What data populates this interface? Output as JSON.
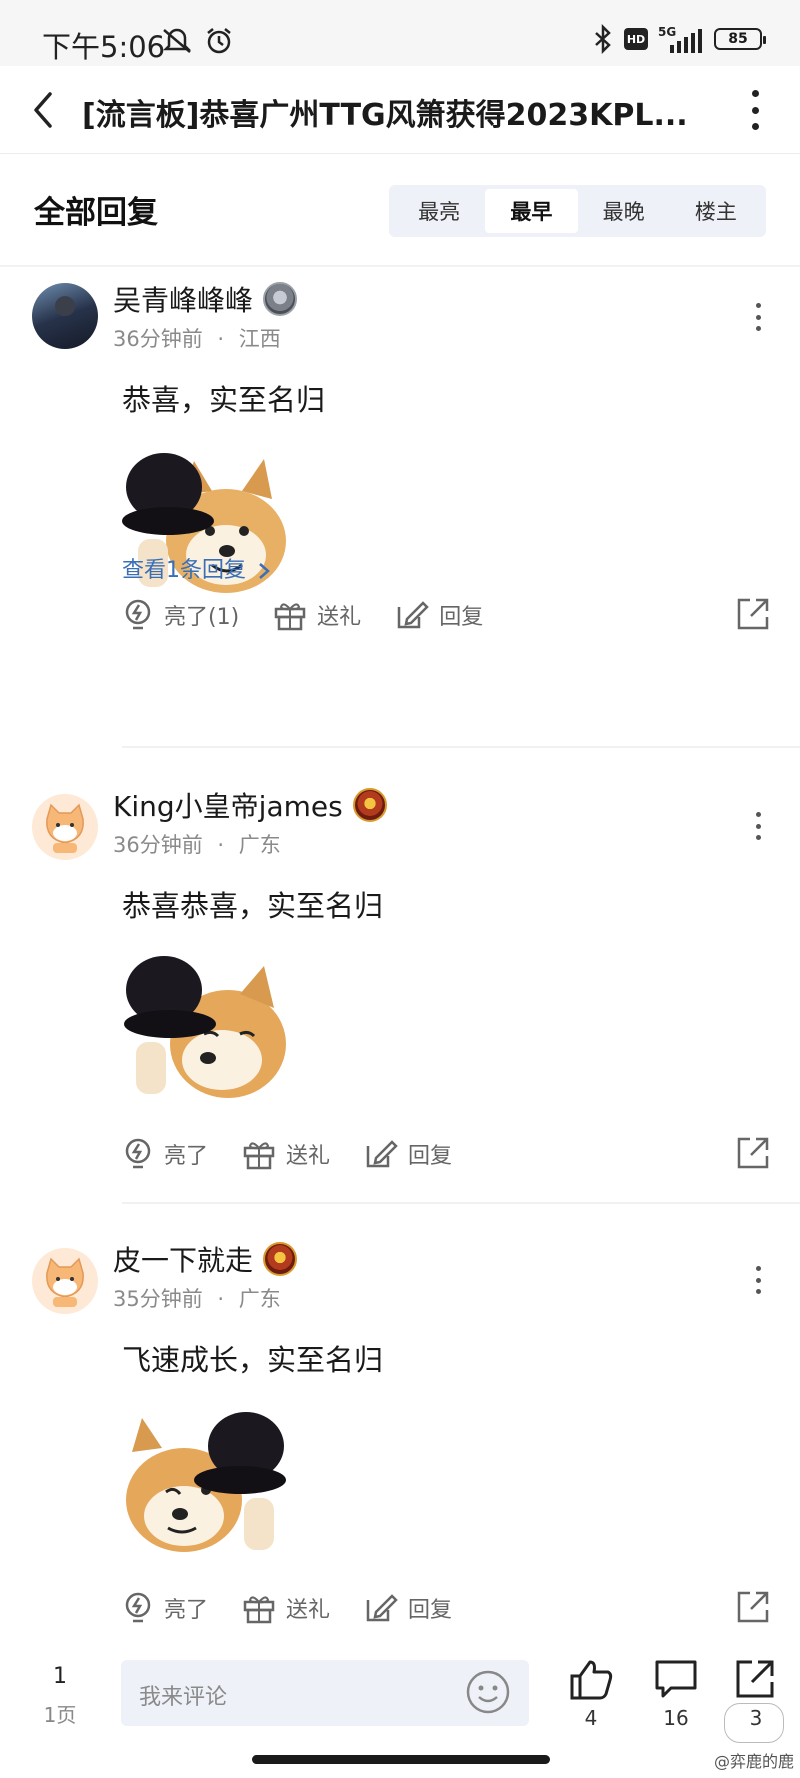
{
  "status_bar": {
    "time": "下午5:06",
    "network": "5G",
    "hd": "HD",
    "battery": "85"
  },
  "header": {
    "title": "[流言板]恭喜广州TTG风箫获得2023KPL..."
  },
  "sort": {
    "section_title": "全部回复",
    "options": [
      "最亮",
      "最早",
      "最晚",
      "楼主"
    ],
    "active": "最早"
  },
  "comments": [
    {
      "username": "吴青峰峰峰",
      "time": "36分钟前",
      "location": "江西",
      "text": "恭喜，实至名归",
      "replies_link": "查看1条回复",
      "actions": {
        "light": "亮了(1)",
        "gift": "送礼",
        "reply": "回复"
      }
    },
    {
      "username": "King小皇帝james",
      "time": "36分钟前",
      "location": "广东",
      "text": "恭喜恭喜，实至名归",
      "actions": {
        "light": "亮了",
        "gift": "送礼",
        "reply": "回复"
      }
    },
    {
      "username": "皮一下就走",
      "time": "35分钟前",
      "location": "广东",
      "text": "飞速成长，实至名归",
      "actions": {
        "light": "亮了",
        "gift": "送礼",
        "reply": "回复"
      }
    }
  ],
  "meta_separator": "·",
  "bottom_bar": {
    "page_number": "1",
    "page_label": "1页",
    "comment_placeholder": "我来评论",
    "likes": "4",
    "comments": "16",
    "shares": "3"
  },
  "watermark": "@弈鹿的鹿",
  "colors": {
    "link_blue": "#3a6fb7",
    "segment_bg": "#eef1f7",
    "meta_gray": "#8a8a8a"
  }
}
